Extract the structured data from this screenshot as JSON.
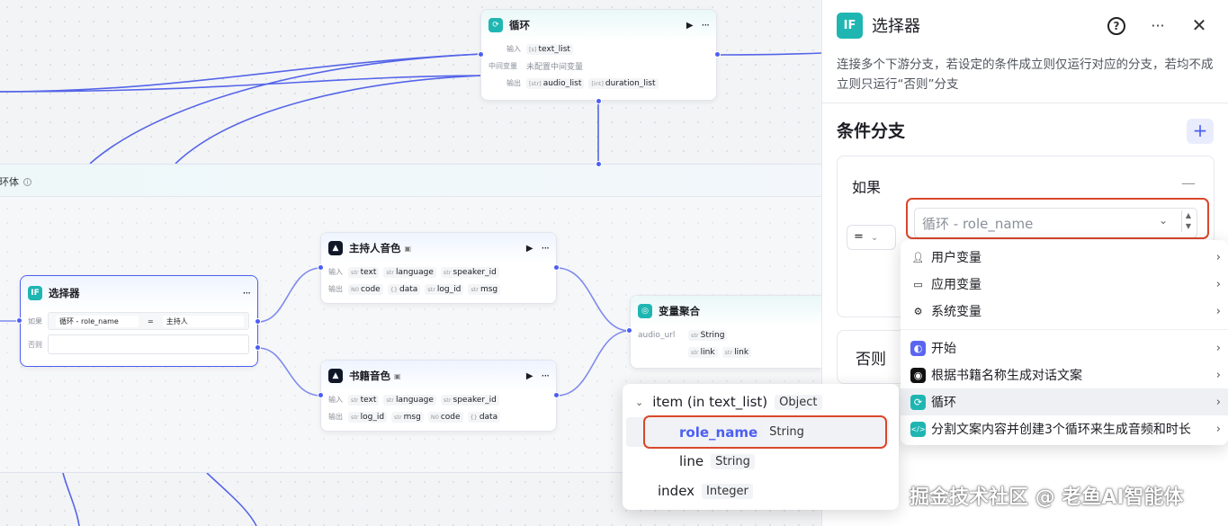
{
  "canvas": {
    "loop_body_label": "环体",
    "loop_node": {
      "title": "循环",
      "input_label": "输入",
      "input_var": "text_list",
      "mid_label": "中间变量",
      "mid_value": "未配置中间变量",
      "output_label": "输出",
      "output_vars": [
        "audio_list",
        "duration_list"
      ]
    },
    "selector_node": {
      "title": "选择器",
      "if_label": "如果",
      "cond_left": "循环 - role_name",
      "cond_op": "=",
      "cond_right": "主持人",
      "else_label": "否则"
    },
    "host_voice_node": {
      "title": "主持人音色",
      "input_label": "输入",
      "inputs": [
        "text",
        "language",
        "speaker_id"
      ],
      "output_label": "输出",
      "outputs": [
        "code",
        "data",
        "log_id",
        "msg"
      ]
    },
    "book_voice_node": {
      "title": "书籍音色",
      "input_label": "输入",
      "inputs": [
        "text",
        "language",
        "speaker_id"
      ],
      "output_label": "输出",
      "outputs": [
        "log_id",
        "msg",
        "code",
        "data"
      ]
    },
    "aggregate_node": {
      "title": "变量聚合",
      "field": "audio_url",
      "vars": [
        "String",
        "link",
        "link"
      ]
    }
  },
  "panel": {
    "title": "选择器",
    "icon_text": "IF",
    "description": "连接多个下游分支，若设定的条件成立则仅运行对应的分支，若均不成立则只运行“否则”分支",
    "section_title": "条件分支",
    "add_label": "+",
    "if_label": "如果",
    "collapse_label": "—",
    "operator": "=",
    "variable_value": "循环 - role_name",
    "else_label": "否则"
  },
  "menu": {
    "items": [
      {
        "label": "用户变量",
        "icon": "user-icon"
      },
      {
        "label": "应用变量",
        "icon": "folder-icon"
      },
      {
        "label": "系统变量",
        "icon": "gear-icon"
      },
      {
        "label": "开始",
        "icon": "start-icon"
      },
      {
        "label": "根据书籍名称生成对话文案",
        "icon": "llm-icon"
      },
      {
        "label": "循环",
        "icon": "loop-icon"
      },
      {
        "label": "分割文案内容并创建3个循环来生成音频和时长",
        "icon": "code-icon"
      }
    ]
  },
  "submenu": {
    "item_label": "item (in text_list)",
    "item_type": "Object",
    "role_name": "role_name",
    "role_name_type": "String",
    "line": "line",
    "line_type": "String",
    "index": "index",
    "index_type": "Integer"
  },
  "watermark": "掘金技术社区 @ 老鱼AI智能体",
  "colors": {
    "accent": "#4c5ef2",
    "teal": "#1fb6b2",
    "highlight": "#d9472b"
  }
}
